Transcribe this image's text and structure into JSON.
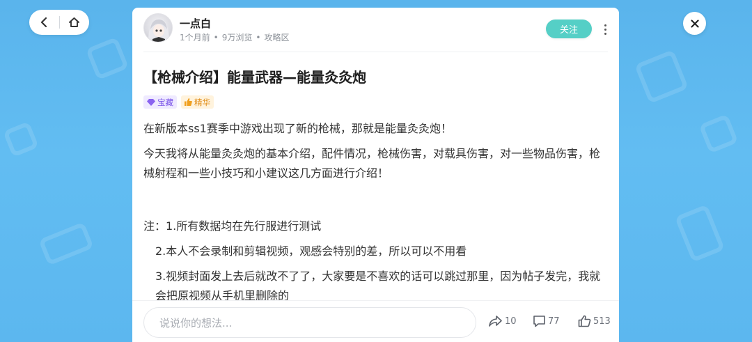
{
  "nav": {
    "back_icon": "chevron-left-icon",
    "home_icon": "home-icon"
  },
  "close_icon": "close-icon",
  "post": {
    "author": {
      "name": "一点白",
      "avatar_icon": "avatar-anime-girl"
    },
    "meta": {
      "time": "1个月前",
      "views": "9万浏览",
      "section": "攻略区"
    },
    "follow_label": "关注",
    "more_icon": "more-vertical-icon",
    "title": "【枪械介绍】能量武器—能量灸灸炮",
    "tags": [
      {
        "label": "宝藏",
        "icon": "diamond-icon",
        "color": "#7b55e8"
      },
      {
        "label": "精华",
        "icon": "thumbs-up-icon",
        "color": "#e08a12"
      }
    ],
    "paragraphs": [
      "在新版本ss1赛季中游戏出现了新的枪械，那就是能量灸灸炮！",
      "今天我将从能量灸灸炮的基本介绍，配件情况，枪械伤害，对载具伤害，对一些物品伤害，枪械射程和一些小技巧和小建议这几方面进行介绍！",
      "注：1.所有数据均在先行服进行测试",
      "2.本人不会录制和剪辑视频，观感会特别的差，所以可以不用看",
      "3.视频封面发上去后就改不了了，大家要是不喜欢的话可以跳过那里，因为帖子发完，我就会把原视频从手机里删除的"
    ]
  },
  "bottom_bar": {
    "comment_placeholder": "说说你的想法...",
    "share_count": "10",
    "comment_count": "77",
    "like_count": "513"
  },
  "colors": {
    "background": "#5ab4ec",
    "follow_button": "#55cfc6"
  }
}
